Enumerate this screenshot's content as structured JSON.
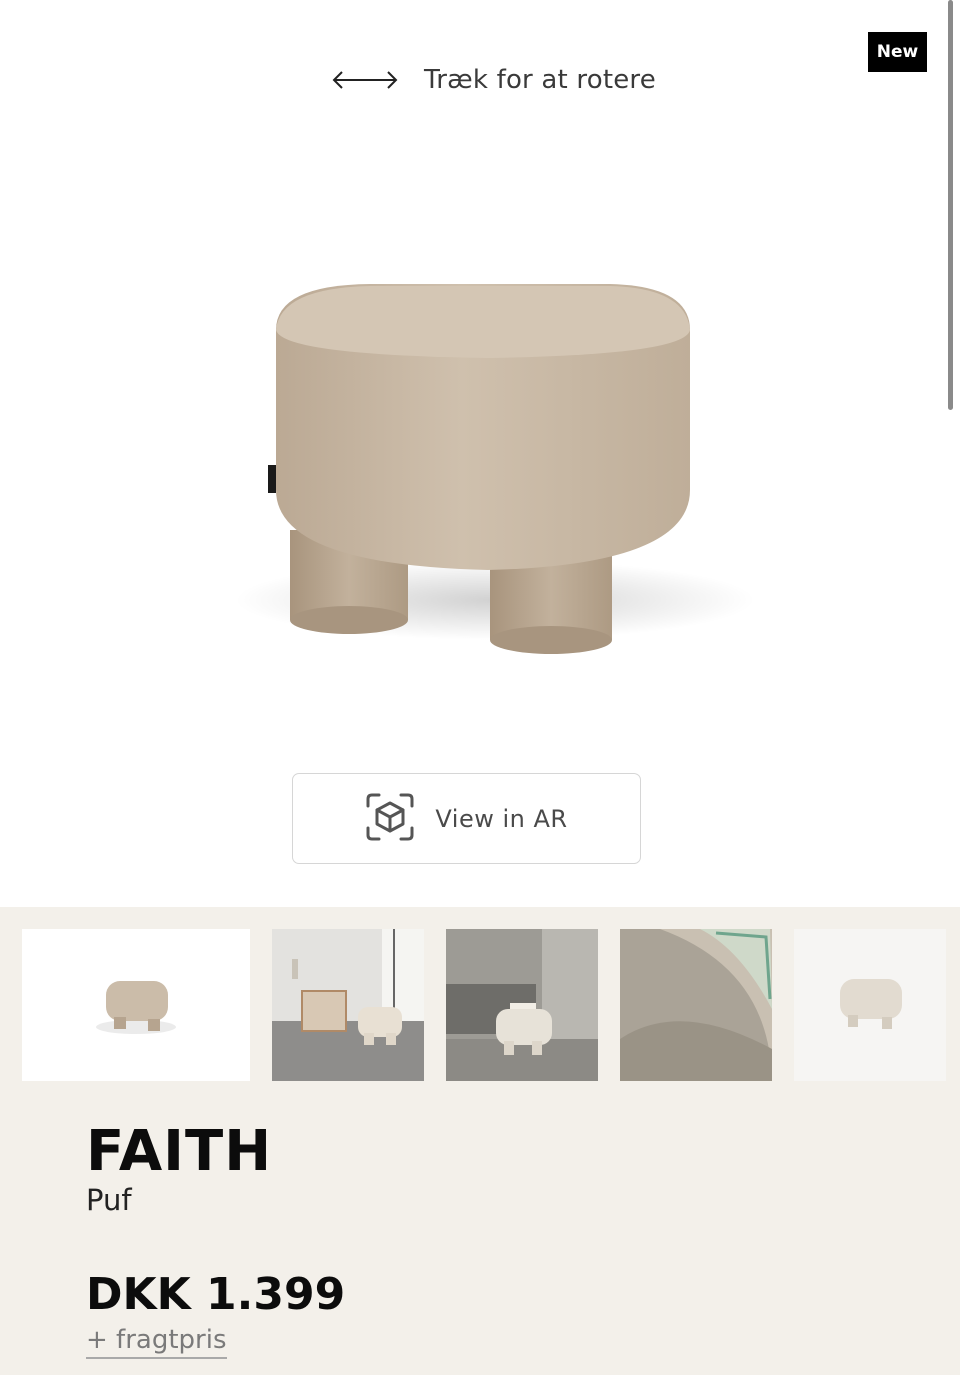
{
  "badge": {
    "label": "New"
  },
  "viewer": {
    "rotate_hint": "Træk for at rotere",
    "ar_button_label": "View in AR"
  },
  "gallery": {
    "thumbnails": [
      {
        "name": "thumbnail-1"
      },
      {
        "name": "thumbnail-2"
      },
      {
        "name": "thumbnail-3"
      },
      {
        "name": "thumbnail-4"
      },
      {
        "name": "thumbnail-5"
      }
    ]
  },
  "product": {
    "name": "FAITH",
    "type": "Puf",
    "price": "DKK 1.399",
    "shipping_link": "+ fragtpris"
  },
  "colors": {
    "background": "#ffffff",
    "panel": "#f3f0ea",
    "fabric": "#c8b8a4",
    "badge": "#000000"
  }
}
